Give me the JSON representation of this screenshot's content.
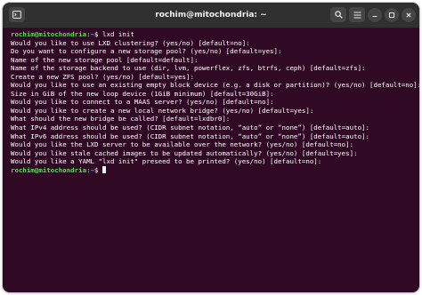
{
  "window": {
    "title": "rochim@mitochondria: ~"
  },
  "colors": {
    "terminal_background": "#300a24",
    "titlebar_background": "#303030",
    "prompt_user": "#4ee24e",
    "prompt_path": "#7aa6e8",
    "text": "#ffffff"
  },
  "toolbar": {
    "new_tab_icon": "new-tab-icon",
    "search_icon": "search-icon",
    "menu_icon": "hamburger-menu-icon",
    "minimize_icon": "minimize-icon",
    "maximize_icon": "maximize-icon",
    "close_icon": "close-icon"
  },
  "terminal": {
    "prompt_1": {
      "user": "rochim@mitochondria",
      "sep": ":",
      "path": "~",
      "symbol": "$ ",
      "command": "lxd init"
    },
    "output": [
      "Would you like to use LXD clustering? (yes/no) [default=no]:",
      "Do you want to configure a new storage pool? (yes/no) [default=yes]:",
      "Name of the new storage pool [default=default]:",
      "Name of the storage backend to use (dir, lvm, powerflex, zfs, btrfs, ceph) [default=zfs]:",
      "Create a new ZFS pool? (yes/no) [default=yes]:",
      "Would you like to use an existing empty block device (e.g. a disk or partition)? (yes/no) [default=no]:",
      "Size in GiB of the new loop device (1GiB minimum) [default=30GiB]:",
      "Would you like to connect to a MAAS server? (yes/no) [default=no]:",
      "Would you like to create a new local network bridge? (yes/no) [default=yes]:",
      "What should the new bridge be called? [default=lxdbr0]:",
      "What IPv4 address should be used? (CIDR subnet notation, “auto” or “none”) [default=auto]:",
      "What IPv6 address should be used? (CIDR subnet notation, “auto” or “none”) [default=auto]:",
      "Would you like the LXD server to be available over the network? (yes/no) [default=no]:",
      "Would you like stale cached images to be updated automatically? (yes/no) [default=yes]:",
      "Would you like a YAML \"lxd init\" preseed to be printed? (yes/no) [default=no]:"
    ],
    "prompt_2": {
      "user": "rochim@mitochondria",
      "sep": ":",
      "path": "~",
      "symbol": "$ "
    }
  }
}
